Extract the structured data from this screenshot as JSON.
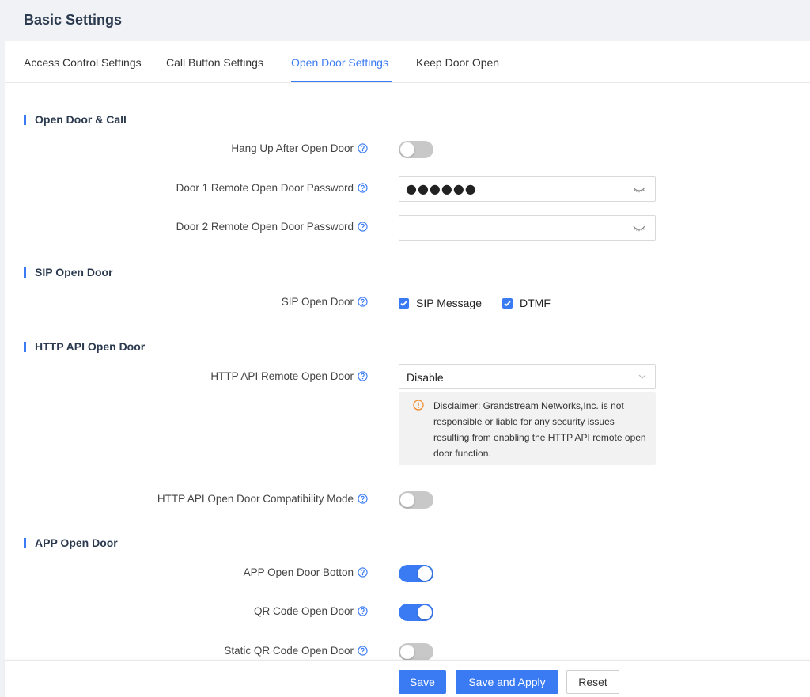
{
  "header": {
    "title": "Basic Settings"
  },
  "tabs": [
    {
      "label": "Access Control Settings"
    },
    {
      "label": "Call Button Settings"
    },
    {
      "label": "Open Door Settings"
    },
    {
      "label": "Keep Door Open"
    }
  ],
  "active_tab": "Open Door Settings",
  "sections": {
    "open_door_call": {
      "title": "Open Door & Call",
      "hang_up": {
        "label": "Hang Up After Open Door",
        "enabled": false
      },
      "door1": {
        "label": "Door 1 Remote Open Door Password",
        "value": "●●●●●●"
      },
      "door2": {
        "label": "Door 2 Remote Open Door Password",
        "value": ""
      }
    },
    "sip_open_door": {
      "title": "SIP Open Door",
      "row": {
        "label": "SIP Open Door"
      },
      "sip_message": {
        "label": "SIP Message",
        "checked": true
      },
      "dtmf": {
        "label": "DTMF",
        "checked": true
      }
    },
    "http_api": {
      "title": "HTTP API Open Door",
      "remote": {
        "label": "HTTP API Remote Open Door",
        "value": "Disable"
      },
      "disclaimer": "Disclaimer: Grandstream Networks,Inc. is not responsible or liable for any security issues resulting from enabling the HTTP API remote open door function.",
      "compat": {
        "label": "HTTP API Open Door Compatibility Mode",
        "enabled": false
      }
    },
    "app_open_door": {
      "title": "APP Open Door",
      "button": {
        "label": "APP Open Door Botton",
        "enabled": true
      },
      "qr": {
        "label": "QR Code Open Door",
        "enabled": true
      },
      "static_qr": {
        "label": "Static QR Code Open Door",
        "enabled": false
      }
    }
  },
  "footer": {
    "save": "Save",
    "save_apply": "Save and Apply",
    "reset": "Reset"
  },
  "colors": {
    "accent": "#3a7bf4",
    "warning": "#f08c2e",
    "toggle_off": "#c8c8c8"
  },
  "icons": [
    "help-icon",
    "eye-closed-icon",
    "chevron-down-icon",
    "warning-icon",
    "checkmark-icon"
  ]
}
